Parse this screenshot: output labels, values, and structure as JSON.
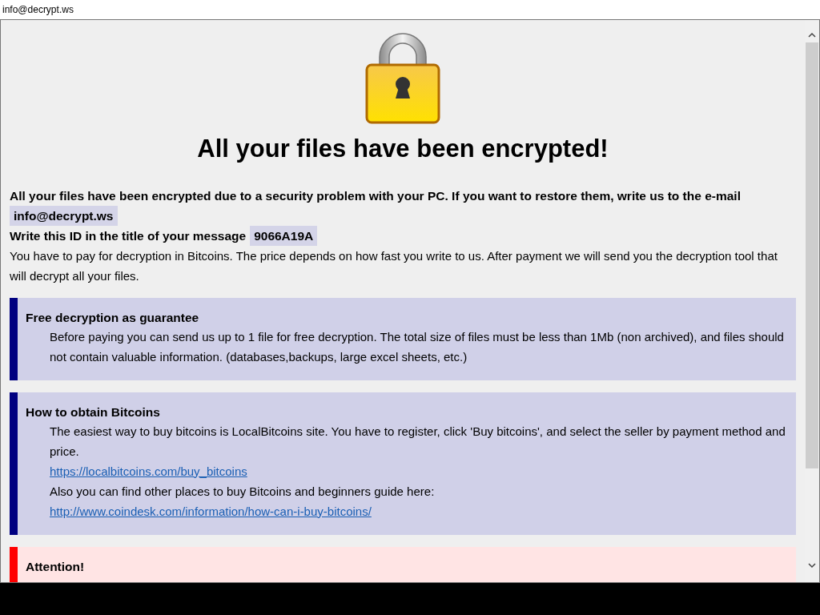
{
  "window": {
    "title": "info@decrypt.ws"
  },
  "heading": "All your files have been encrypted!",
  "intro": {
    "text": "All your files have been encrypted due to a security problem with your PC. If you want to restore them, write us to the e-mail",
    "email": "info@decrypt.ws"
  },
  "id_line": {
    "label": "Write this ID in the title of your message",
    "id": "9066A19A"
  },
  "payment_note": "You have to pay for decryption in Bitcoins. The price depends on how fast you write to us. After payment we will send you the decryption tool that will decrypt all your files.",
  "sections": [
    {
      "kind": "info",
      "color": "#000080",
      "title": "Free decryption as guarantee",
      "lines": [
        {
          "kind": "text",
          "text": "Before paying you can send us up to 1 file for free decryption. The total size of files must be less than 1Mb (non archived), and files should not contain valuable information. (databases,backups, large excel sheets, etc.)"
        }
      ]
    },
    {
      "kind": "info",
      "color": "#000080",
      "title": "How to obtain Bitcoins",
      "lines": [
        {
          "kind": "text",
          "text": "The easiest way to buy bitcoins is LocalBitcoins site. You have to register, click 'Buy bitcoins', and select the seller by payment method and price."
        },
        {
          "kind": "link",
          "text": "https://localbitcoins.com/buy_bitcoins"
        },
        {
          "kind": "text",
          "text": "Also you can find other places to buy Bitcoins and beginners guide here:"
        },
        {
          "kind": "link",
          "text": "http://www.coindesk.com/information/how-can-i-buy-bitcoins/"
        }
      ]
    },
    {
      "kind": "warning",
      "color": "#ff0000",
      "title": "Attention!"
    }
  ]
}
